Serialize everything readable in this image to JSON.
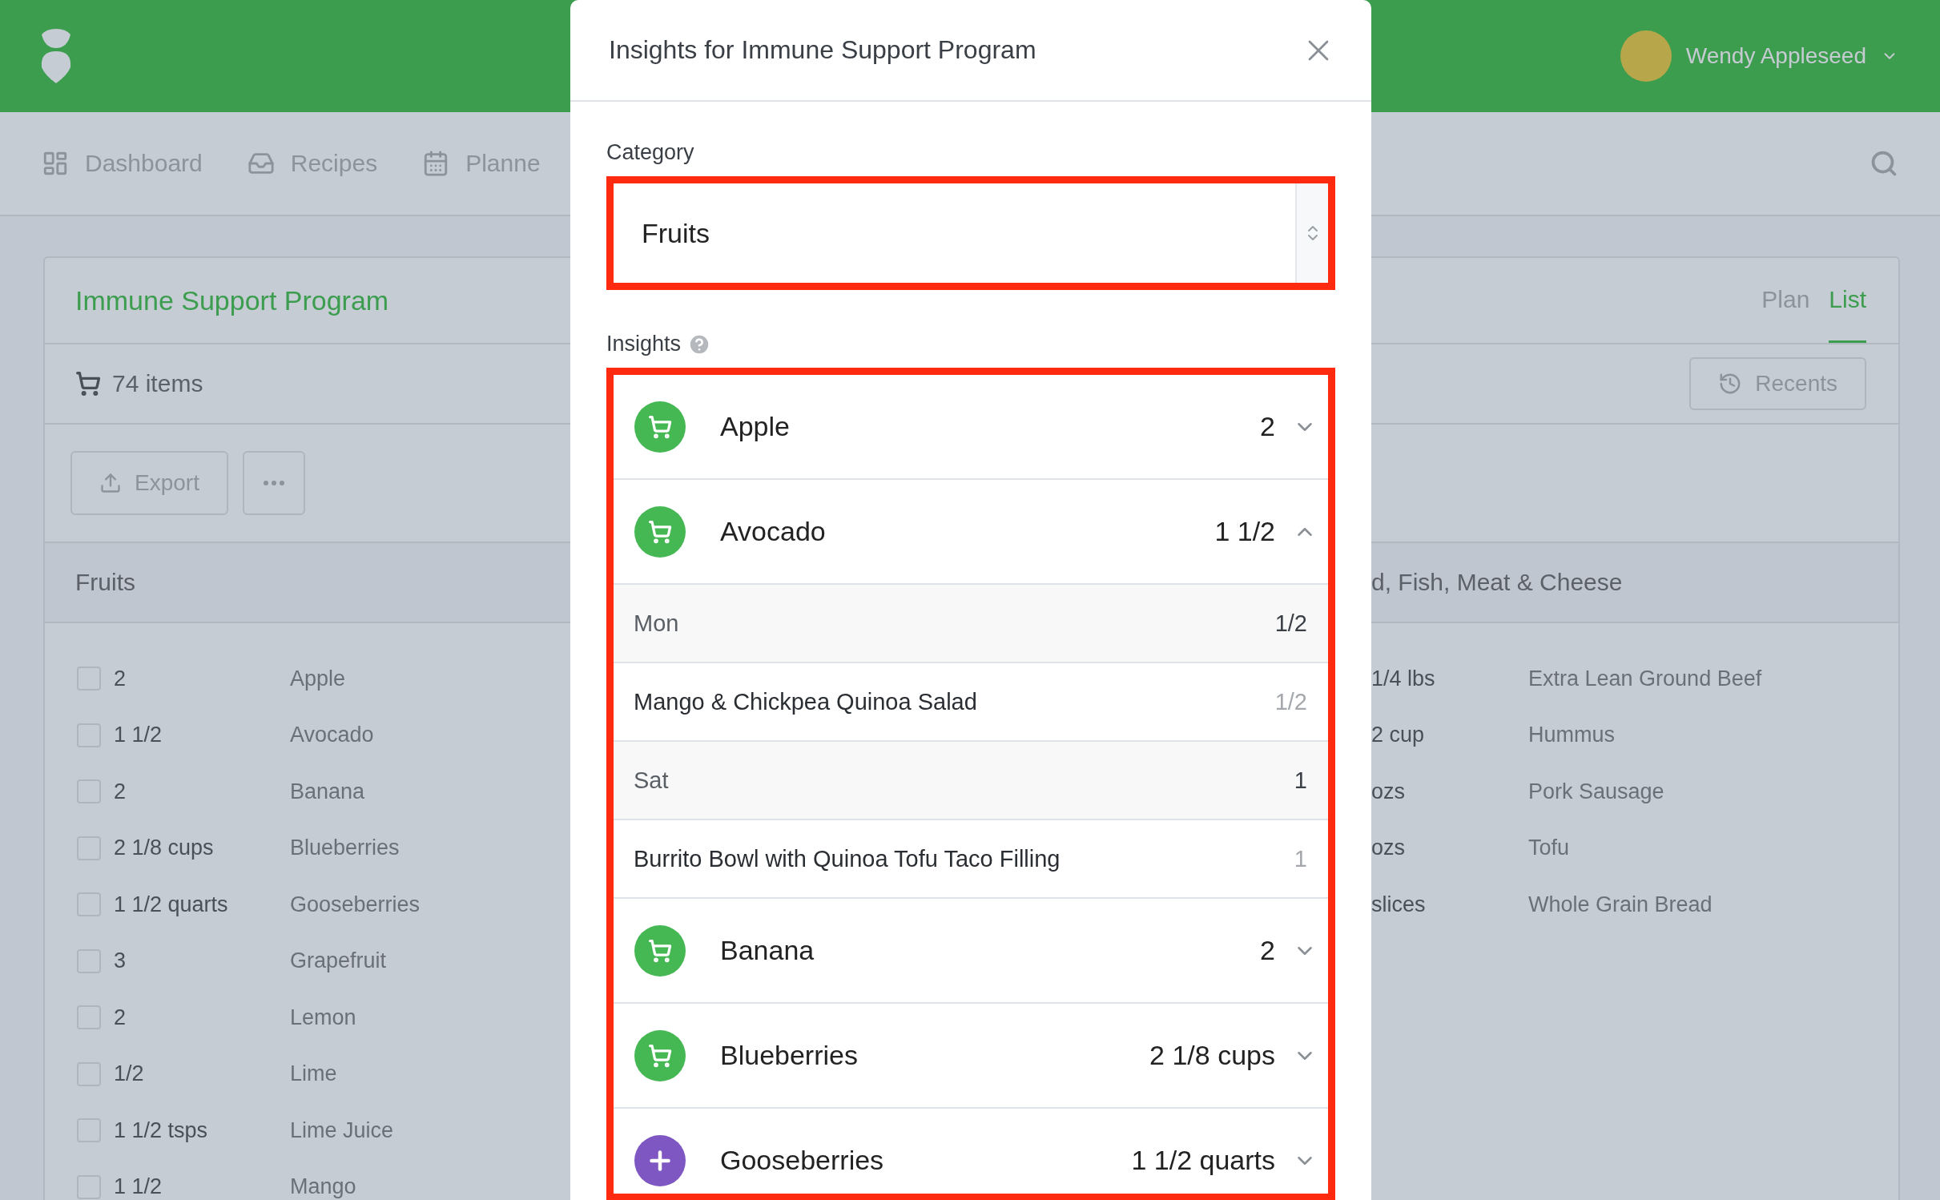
{
  "header": {
    "user": {
      "name": "Wendy Appleseed"
    }
  },
  "nav": {
    "items": [
      {
        "label": "Dashboard",
        "kind": "dashboard"
      },
      {
        "label": "Recipes",
        "kind": "recipes"
      },
      {
        "label": "Planne",
        "kind": "planner"
      }
    ]
  },
  "program": {
    "title": "Immune Support Program",
    "tabs": [
      {
        "label": "Plan",
        "selected": false
      },
      {
        "label": "List",
        "selected": true
      }
    ],
    "item_count": "74 items",
    "recents": "Recents",
    "export": "Export",
    "sections": [
      {
        "title": "Fruits",
        "items": [
          {
            "quantity": "2",
            "name": "Apple",
            "checked": false
          },
          {
            "quantity": "1 1/2",
            "name": "Avocado",
            "checked": false
          },
          {
            "quantity": "2",
            "name": "Banana",
            "checked": false
          },
          {
            "quantity": "2 1/8 cups",
            "name": "Blueberries",
            "checked": false
          },
          {
            "quantity": "1 1/2 quarts",
            "name": "Gooseberries",
            "checked": false
          },
          {
            "quantity": "3",
            "name": "Grapefruit",
            "checked": false
          },
          {
            "quantity": "2",
            "name": "Lemon",
            "checked": false
          },
          {
            "quantity": "1/2",
            "name": "Lime",
            "checked": false
          },
          {
            "quantity": "1 1/2 tsps",
            "name": "Lime Juice",
            "checked": false
          },
          {
            "quantity": "1 1/2",
            "name": "Mango",
            "checked": false
          }
        ]
      },
      {
        "title": "d, Fish, Meat & Cheese",
        "items": [
          {
            "quantity": "1/4 lbs",
            "name": "Extra Lean Ground Beef"
          },
          {
            "quantity": "2 cup",
            "name": "Hummus"
          },
          {
            "quantity": "ozs",
            "name": "Pork Sausage"
          },
          {
            "quantity": "ozs",
            "name": "Tofu"
          },
          {
            "quantity": "slices",
            "name": "Whole Grain Bread"
          }
        ]
      }
    ]
  },
  "modal": {
    "title": "Insights for Immune Support Program",
    "category_label": "Category",
    "category_value": "Fruits",
    "insights_label": "Insights",
    "insights": [
      {
        "name": "Apple",
        "quantity": "2",
        "kind": "cart",
        "expanded": false
      },
      {
        "name": "Avocado",
        "quantity": "1 1/2",
        "kind": "cart",
        "expanded": true,
        "children": [
          {
            "kind": "day",
            "label": "Mon",
            "quantity": "1/2"
          },
          {
            "kind": "recipe",
            "label": "Mango & Chickpea Quinoa Salad",
            "quantity": "1/2"
          },
          {
            "kind": "day",
            "label": "Sat",
            "quantity": "1"
          },
          {
            "kind": "recipe",
            "label": "Burrito Bowl with Quinoa Tofu Taco Filling",
            "quantity": "1"
          }
        ]
      },
      {
        "name": "Banana",
        "quantity": "2",
        "kind": "cart",
        "expanded": false
      },
      {
        "name": "Blueberries",
        "quantity": "2 1/8 cups",
        "kind": "cart",
        "expanded": false
      },
      {
        "name": "Gooseberries",
        "quantity": "1 1/2 quarts",
        "kind": "add",
        "expanded": false
      }
    ]
  }
}
